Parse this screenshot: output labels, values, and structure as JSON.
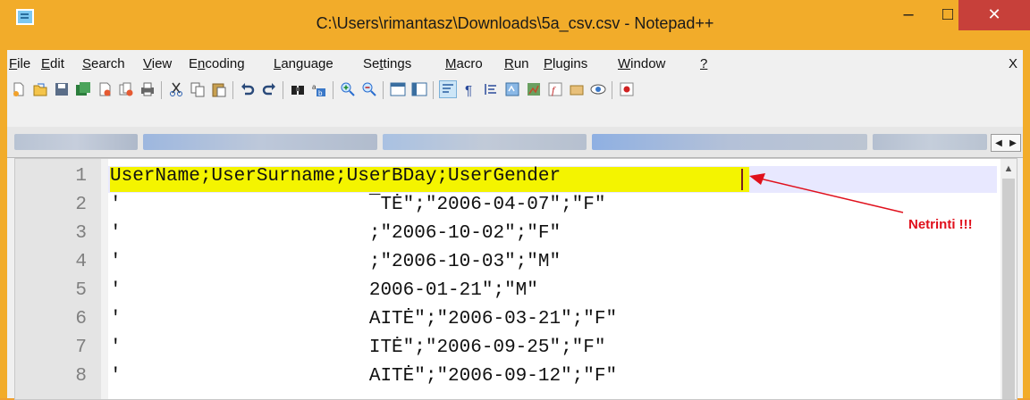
{
  "window": {
    "title": "C:\\Users\\rimantasz\\Downloads\\5a_csv.csv - Notepad++",
    "controls": {
      "minimize": "–",
      "maximize": "□",
      "close": "✕"
    }
  },
  "menu": {
    "items": [
      {
        "key": "F",
        "rest": "ile"
      },
      {
        "key": "E",
        "rest": "dit"
      },
      {
        "key": "S",
        "rest": "earch"
      },
      {
        "key": "V",
        "rest": "iew"
      },
      {
        "key": "E",
        "rest": "ncoding",
        "pre": ""
      },
      {
        "key": "L",
        "rest": "anguage"
      },
      {
        "pre": "Se",
        "key": "t",
        "rest": "tings"
      },
      {
        "key": "M",
        "rest": "acro"
      },
      {
        "key": "R",
        "rest": "un"
      },
      {
        "key": "P",
        "rest": "lugins"
      },
      {
        "key": "W",
        "rest": "indow"
      },
      {
        "key": "?",
        "rest": ""
      }
    ],
    "close_doc": "X"
  },
  "toolbar": {
    "icons": [
      "new-file-icon",
      "open-file-icon",
      "save-icon",
      "save-all-icon",
      "close-icon",
      "close-all-icon",
      "print-icon",
      "cut-icon",
      "copy-icon",
      "paste-icon",
      "undo-icon",
      "redo-icon",
      "find-icon",
      "replace-icon",
      "zoom-in-icon",
      "zoom-out-icon",
      "sync-v-icon",
      "sync-h-icon",
      "word-wrap-icon",
      "show-all-chars-icon",
      "indent-guide-icon",
      "user-lang-icon",
      "doc-map-icon",
      "function-list-icon",
      "folder-workspace-icon",
      "monitor-icon",
      "record-macro-icon"
    ]
  },
  "editor": {
    "line_numbers": [
      "1",
      "2",
      "3",
      "4",
      "5",
      "6",
      "7",
      "8"
    ],
    "lines": [
      "UserName;UserSurname;UserBDay;UserGender",
      "'                      ¯TĖ\";\"2006-04-07\";\"F\"",
      "'                      ;\"2006-10-02\";\"F\"",
      "'                      ;\"2006-10-03\";\"M\"",
      "'                      2006-01-21\";\"M\"",
      "'                      AITĖ\";\"2006-03-21\";\"F\"",
      "'                      ITĖ\";\"2006-09-25\";\"F\"",
      "'                      AITĖ\";\"2006-09-12\";\"F\""
    ],
    "accent_highlight": "#f4f400"
  },
  "annotation": {
    "text": "Netrinti !!!",
    "color": "#e0101c"
  }
}
